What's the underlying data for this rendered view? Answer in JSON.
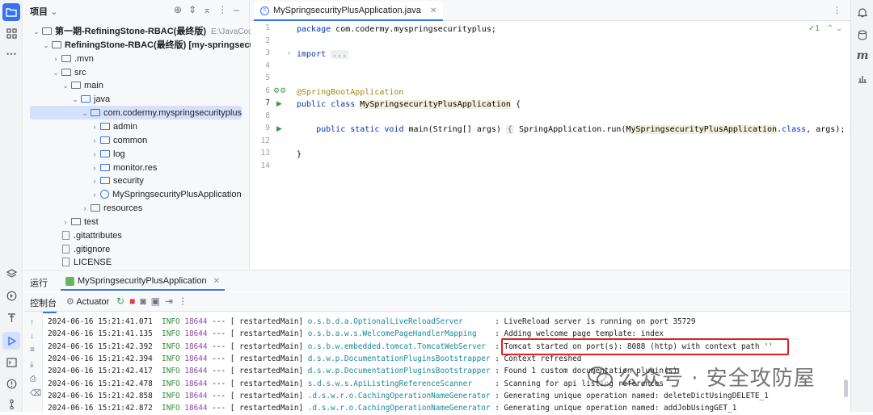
{
  "project_panel": {
    "title": "项目",
    "tree": [
      {
        "label": "第一期-RefiningStone-RBAC(最终版)",
        "hint": "E:\\JavaCode\\J",
        "arrow": "⌄",
        "type": "folder",
        "bold": true
      },
      {
        "label": "RefiningStone-RBAC(最终版) [my-springsecurity-p",
        "arrow": "⌄",
        "type": "folder",
        "bold": true
      },
      {
        "label": ".mvn",
        "arrow": "›",
        "type": "folder"
      },
      {
        "label": "src",
        "arrow": "⌄",
        "type": "folder"
      },
      {
        "label": "main",
        "arrow": "⌄",
        "type": "folder"
      },
      {
        "label": "java",
        "arrow": "⌄",
        "type": "folder-blue"
      },
      {
        "label": "com.codermy.myspringsecurityplus",
        "arrow": "⌄",
        "type": "package",
        "selected": true
      },
      {
        "label": "admin",
        "arrow": "›",
        "type": "package"
      },
      {
        "label": "common",
        "arrow": "›",
        "type": "package"
      },
      {
        "label": "log",
        "arrow": "›",
        "type": "package"
      },
      {
        "label": "monitor.res",
        "arrow": "›",
        "type": "package"
      },
      {
        "label": "security",
        "arrow": "›",
        "type": "package"
      },
      {
        "label": "MySpringsecurityPlusApplication",
        "arrow": "›",
        "type": "class"
      },
      {
        "label": "resources",
        "arrow": "›",
        "type": "folder"
      },
      {
        "label": "test",
        "arrow": "›",
        "type": "folder"
      },
      {
        "label": ".gitattributes",
        "arrow": "",
        "type": "file"
      },
      {
        "label": ".gitignore",
        "arrow": "",
        "type": "file"
      },
      {
        "label": "LICENSE",
        "arrow": "",
        "type": "file"
      }
    ]
  },
  "editor": {
    "tab_label": "MySpringsecurityPlusApplication.java",
    "inspection_count": "1",
    "lines": [
      {
        "n": "1",
        "html": "<span class=\"kw\">package</span> com.codermy.myspringsecurityplus;"
      },
      {
        "n": "2",
        "html": ""
      },
      {
        "n": "3",
        "html": "<span class=\"kw\">import</span> <span class=\"fold\">...</span>"
      },
      {
        "n": "4",
        "html": ""
      },
      {
        "n": "5",
        "html": ""
      },
      {
        "n": "6",
        "html": "<span class=\"ann\">@SpringBootApplication</span>"
      },
      {
        "n": "7",
        "html": "<span class=\"kw\">public class</span> <span class=\"cls\">MySpringsecurityPlusApplication</span> {"
      },
      {
        "n": "8",
        "html": ""
      },
      {
        "n": "9",
        "html": "    <span class=\"kw\">public static void</span> main(String[] args) <span class=\"fold\">{</span> SpringApplication.run(<span class=\"cls\">MySpringsecurityPlusApplication</span>.<span class=\"kw\">class</span>, args); <span class=\"fold\">}</span>"
      },
      {
        "n": "12",
        "html": ""
      },
      {
        "n": "13",
        "html": "}"
      },
      {
        "n": "14",
        "html": ""
      }
    ]
  },
  "run_panel": {
    "tab_run": "运行",
    "tab_config": "MySpringsecurityPlusApplication",
    "console_label": "控制台",
    "actuator_label": "Actuator",
    "logs": [
      {
        "time": "2024-06-16 15:21:41.071",
        "level": "INFO",
        "pid": "18644",
        "sep": "--- [",
        "thread": " restartedMain]",
        "cls": "o.s.b.d.a.OptionalLiveReloadServer      ",
        "msg": " : LiveReload server is running on port 35729"
      },
      {
        "time": "2024-06-16 15:21:41.135",
        "level": "INFO",
        "pid": "18644",
        "sep": "--- [",
        "thread": " restartedMain]",
        "cls": "o.s.b.a.w.s.WelcomePageHandlerMapping   ",
        "msg": " : Adding welcome page template: index"
      },
      {
        "time": "2024-06-16 15:21:42.392",
        "level": "INFO",
        "pid": "18644",
        "sep": "--- [",
        "thread": " restartedMain]",
        "cls": "o.s.b.w.embedded.tomcat.TomcatWebServer ",
        "msg": " : Tomcat started on port(s): 8088 (http) with context path ''"
      },
      {
        "time": "2024-06-16 15:21:42.394",
        "level": "INFO",
        "pid": "18644",
        "sep": "--- [",
        "thread": " restartedMain]",
        "cls": "d.s.w.p.DocumentationPluginsBootstrapper",
        "msg": " : Context refreshed"
      },
      {
        "time": "2024-06-16 15:21:42.417",
        "level": "INFO",
        "pid": "18644",
        "sep": "--- [",
        "thread": " restartedMain]",
        "cls": "d.s.w.p.DocumentationPluginsBootstrapper",
        "msg": " : Found 1 custom documentation plugin(s)"
      },
      {
        "time": "2024-06-16 15:21:42.478",
        "level": "INFO",
        "pid": "18644",
        "sep": "--- [",
        "thread": " restartedMain]",
        "cls": "s.d.s.w.s.ApiListingReferenceScanner    ",
        "msg": " : Scanning for api listing references"
      },
      {
        "time": "2024-06-16 15:21:42.858",
        "level": "INFO",
        "pid": "18644",
        "sep": "--- [",
        "thread": " restartedMain]",
        "cls": ".d.s.w.r.o.CachingOperationNameGenerator",
        "msg": " : Generating unique operation named: deleteDictUsingDELETE_1"
      },
      {
        "time": "2024-06-16 15:21:42.872",
        "level": "INFO",
        "pid": "18644",
        "sep": "--- [",
        "thread": " restartedMain]",
        "cls": ".d.s.w.r.o.CachingOperationNameGenerator",
        "msg": " : Generating unique operation named: addJobUsingGET_1"
      }
    ]
  },
  "watermark": "公众号 · 安全攻防屋",
  "colors": {
    "accent": "#3574f0",
    "highlight_box": "#e02020",
    "selected_row": "#d5e1fb"
  }
}
